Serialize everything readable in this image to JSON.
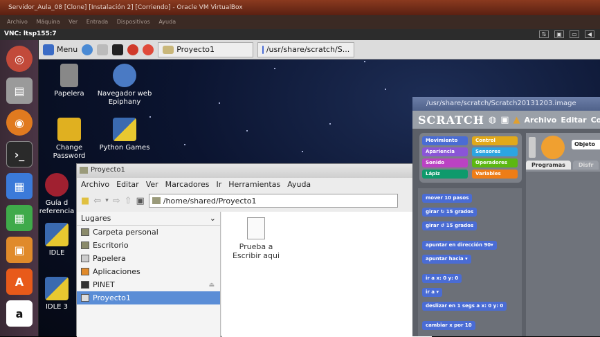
{
  "vbox": {
    "title": "Servidor_Aula_08 [Clone] [Instalación 2] [Corriendo] - Oracle VM VirtualBox",
    "menu": [
      "Archivo",
      "Máquina",
      "Ver",
      "Entrada",
      "Dispositivos",
      "Ayuda"
    ]
  },
  "vnc": {
    "title": "VNC: ltsp155:7"
  },
  "taskbar": {
    "menu_label": "Menu",
    "task1": "Proyecto1",
    "task2": "/usr/share/scratch/S..."
  },
  "desktop_icons": [
    {
      "label": "Papelera"
    },
    {
      "label": "Navegador web Epiphany"
    },
    {
      "label": "Change Password"
    },
    {
      "label": "Python Games"
    },
    {
      "label": "Guía d referencia"
    },
    {
      "label": "IDLE"
    },
    {
      "label": "IDLE 3"
    }
  ],
  "file_manager": {
    "title": "Proyecto1",
    "menu": [
      "Archivo",
      "Editar",
      "Ver",
      "Marcadores",
      "Ir",
      "Herramientas",
      "Ayuda"
    ],
    "path": "/home/shared/Proyecto1",
    "places_header": "Lugares",
    "places": [
      "Carpeta personal",
      "Escritorio",
      "Papelera",
      "Aplicaciones",
      "PINET",
      "Proyecto1"
    ],
    "selected_place": "Proyecto1",
    "file": "Prueba a Escribir aqui"
  },
  "scratch": {
    "title": "/usr/share/scratch/Scratch20131203.image",
    "logo": "SCRATCH",
    "menu": [
      "Archivo",
      "Editar",
      "Comp"
    ],
    "categories": [
      {
        "label": "Movimiento",
        "color": "#4a6cd4"
      },
      {
        "label": "Control",
        "color": "#e1a91a"
      },
      {
        "label": "Apariencia",
        "color": "#8a55d7"
      },
      {
        "label": "Sensores",
        "color": "#2ca5e2"
      },
      {
        "label": "Sonido",
        "color": "#bb42c3"
      },
      {
        "label": "Operadores",
        "color": "#5cb712"
      },
      {
        "label": "Lápiz",
        "color": "#0e9a6c"
      },
      {
        "label": "Variables",
        "color": "#ee7d16"
      }
    ],
    "blocks": [
      "mover 10 pasos",
      "girar ↻ 15 grados",
      "girar ↺ 15 grados",
      "apuntar en dirección 90▾",
      "apuntar hacia ▾",
      "ir a x: 0 y: 0",
      "ir a ▾",
      "deslizar en 1 segs a x: 0 y: 0",
      "cambiar x por 10"
    ],
    "tabs": [
      "Programas",
      "Disfr"
    ],
    "object_label": "Objeto"
  }
}
